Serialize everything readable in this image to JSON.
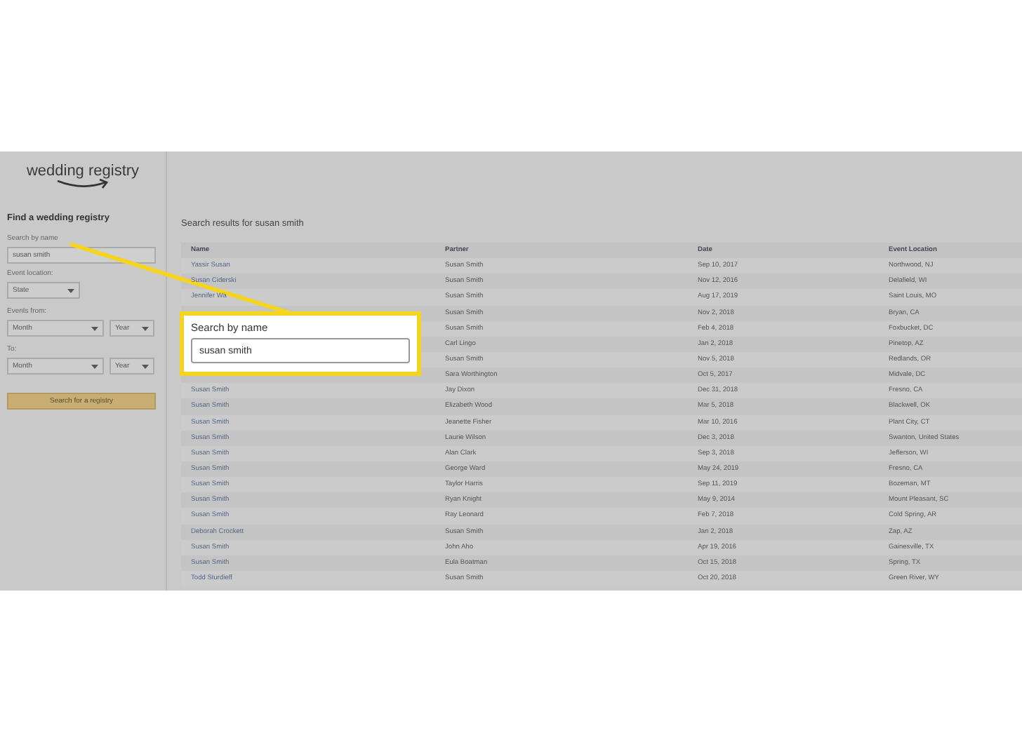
{
  "logo": {
    "text": "wedding registry"
  },
  "sidebar": {
    "title": "Find a wedding registry",
    "name_field": {
      "label": "Search by name",
      "value": "susan smith"
    },
    "location": {
      "label": "Event location:",
      "select": "State"
    },
    "from": {
      "label": "Events from:",
      "month": "Month",
      "year": "Year"
    },
    "to": {
      "label": "To:",
      "month": "Month",
      "year": "Year"
    },
    "button": "Search for a registry"
  },
  "results": {
    "title": "Search results for susan smith",
    "columns": [
      "Name",
      "Partner",
      "Date",
      "Event Location"
    ],
    "rows": [
      {
        "name": "Yassir Susan",
        "partner": "Susan Smith",
        "date": "Sep 10, 2017",
        "location": "Northwood, NJ"
      },
      {
        "name": "Susan Ciderski",
        "partner": "Susan Smith",
        "date": "Nov 12, 2016",
        "location": "Delafield, WI"
      },
      {
        "name": "Jennifer Wa",
        "partner": "Susan Smith",
        "date": "Aug 17, 2019",
        "location": "Saint Louis, MO"
      },
      {
        "partner": "Susan Smith",
        "date": "Nov 2, 2018",
        "location": "Bryan, CA"
      },
      {
        "partner": "Susan Smith",
        "date": "Feb 4, 2018",
        "location": "Foxbucket, DC"
      },
      {
        "partner": "Carl Lingo",
        "date": "Jan 2, 2018",
        "location": "Pinetop, AZ"
      },
      {
        "partner": "Susan Smith",
        "date": "Nov 5, 2018",
        "location": "Redlands, OR"
      },
      {
        "partner": "Sara Worthington",
        "date": "Oct 5, 2017",
        "location": "Midvale, DC"
      },
      {
        "name": "Susan Smith",
        "partner": "Jay Dixon",
        "date": "Dec 31, 2018",
        "location": "Fresno, CA"
      },
      {
        "name": "Susan Smith",
        "partner": "Elizabeth Wood",
        "date": "Mar 5, 2018",
        "location": "Blackwell, OK"
      },
      {
        "name": "Susan Smith",
        "partner": "Jeanette Fisher",
        "date": "Mar 10, 2016",
        "location": "Plant City, CT"
      },
      {
        "name": "Susan Smith",
        "partner": "Laurie Wilson",
        "date": "Dec 3, 2018",
        "location": "Swanton, United States"
      },
      {
        "name": "Susan Smith",
        "partner": "Alan Clark",
        "date": "Sep 3, 2018",
        "location": "Jefferson, WI"
      },
      {
        "name": "Susan Smith",
        "partner": "George Ward",
        "date": "May 24, 2019",
        "location": "Fresno, CA"
      },
      {
        "name": "Susan Smith",
        "partner": "Taylor Harris",
        "date": "Sep 11, 2019",
        "location": "Bozeman, MT"
      },
      {
        "name": "Susan Smith",
        "partner": "Ryan Knight",
        "date": "May 9, 2014",
        "location": "Mount Pleasant, SC"
      },
      {
        "name": "Susan Smith",
        "partner": "Ray Leonard",
        "date": "Feb 7, 2018",
        "location": "Cold Spring, AR"
      },
      {
        "name": "Deborah Crockett",
        "partner": "Susan Smith",
        "date": "Jan 2, 2018",
        "location": "Zap, AZ"
      },
      {
        "name": "Susan Smith",
        "partner": "John Aho",
        "date": "Apr 19, 2016",
        "location": "Gainesville, TX"
      },
      {
        "name": "Susan Smith",
        "partner": "Eula Boatman",
        "date": "Oct 15, 2018",
        "location": "Spring, TX"
      },
      {
        "name": "Todd Sturdieff",
        "partner": "Susan Smith",
        "date": "Oct 20, 2018",
        "location": "Green River, WY"
      }
    ]
  },
  "callout": {
    "label": "Search by name",
    "value": "susan smith"
  }
}
